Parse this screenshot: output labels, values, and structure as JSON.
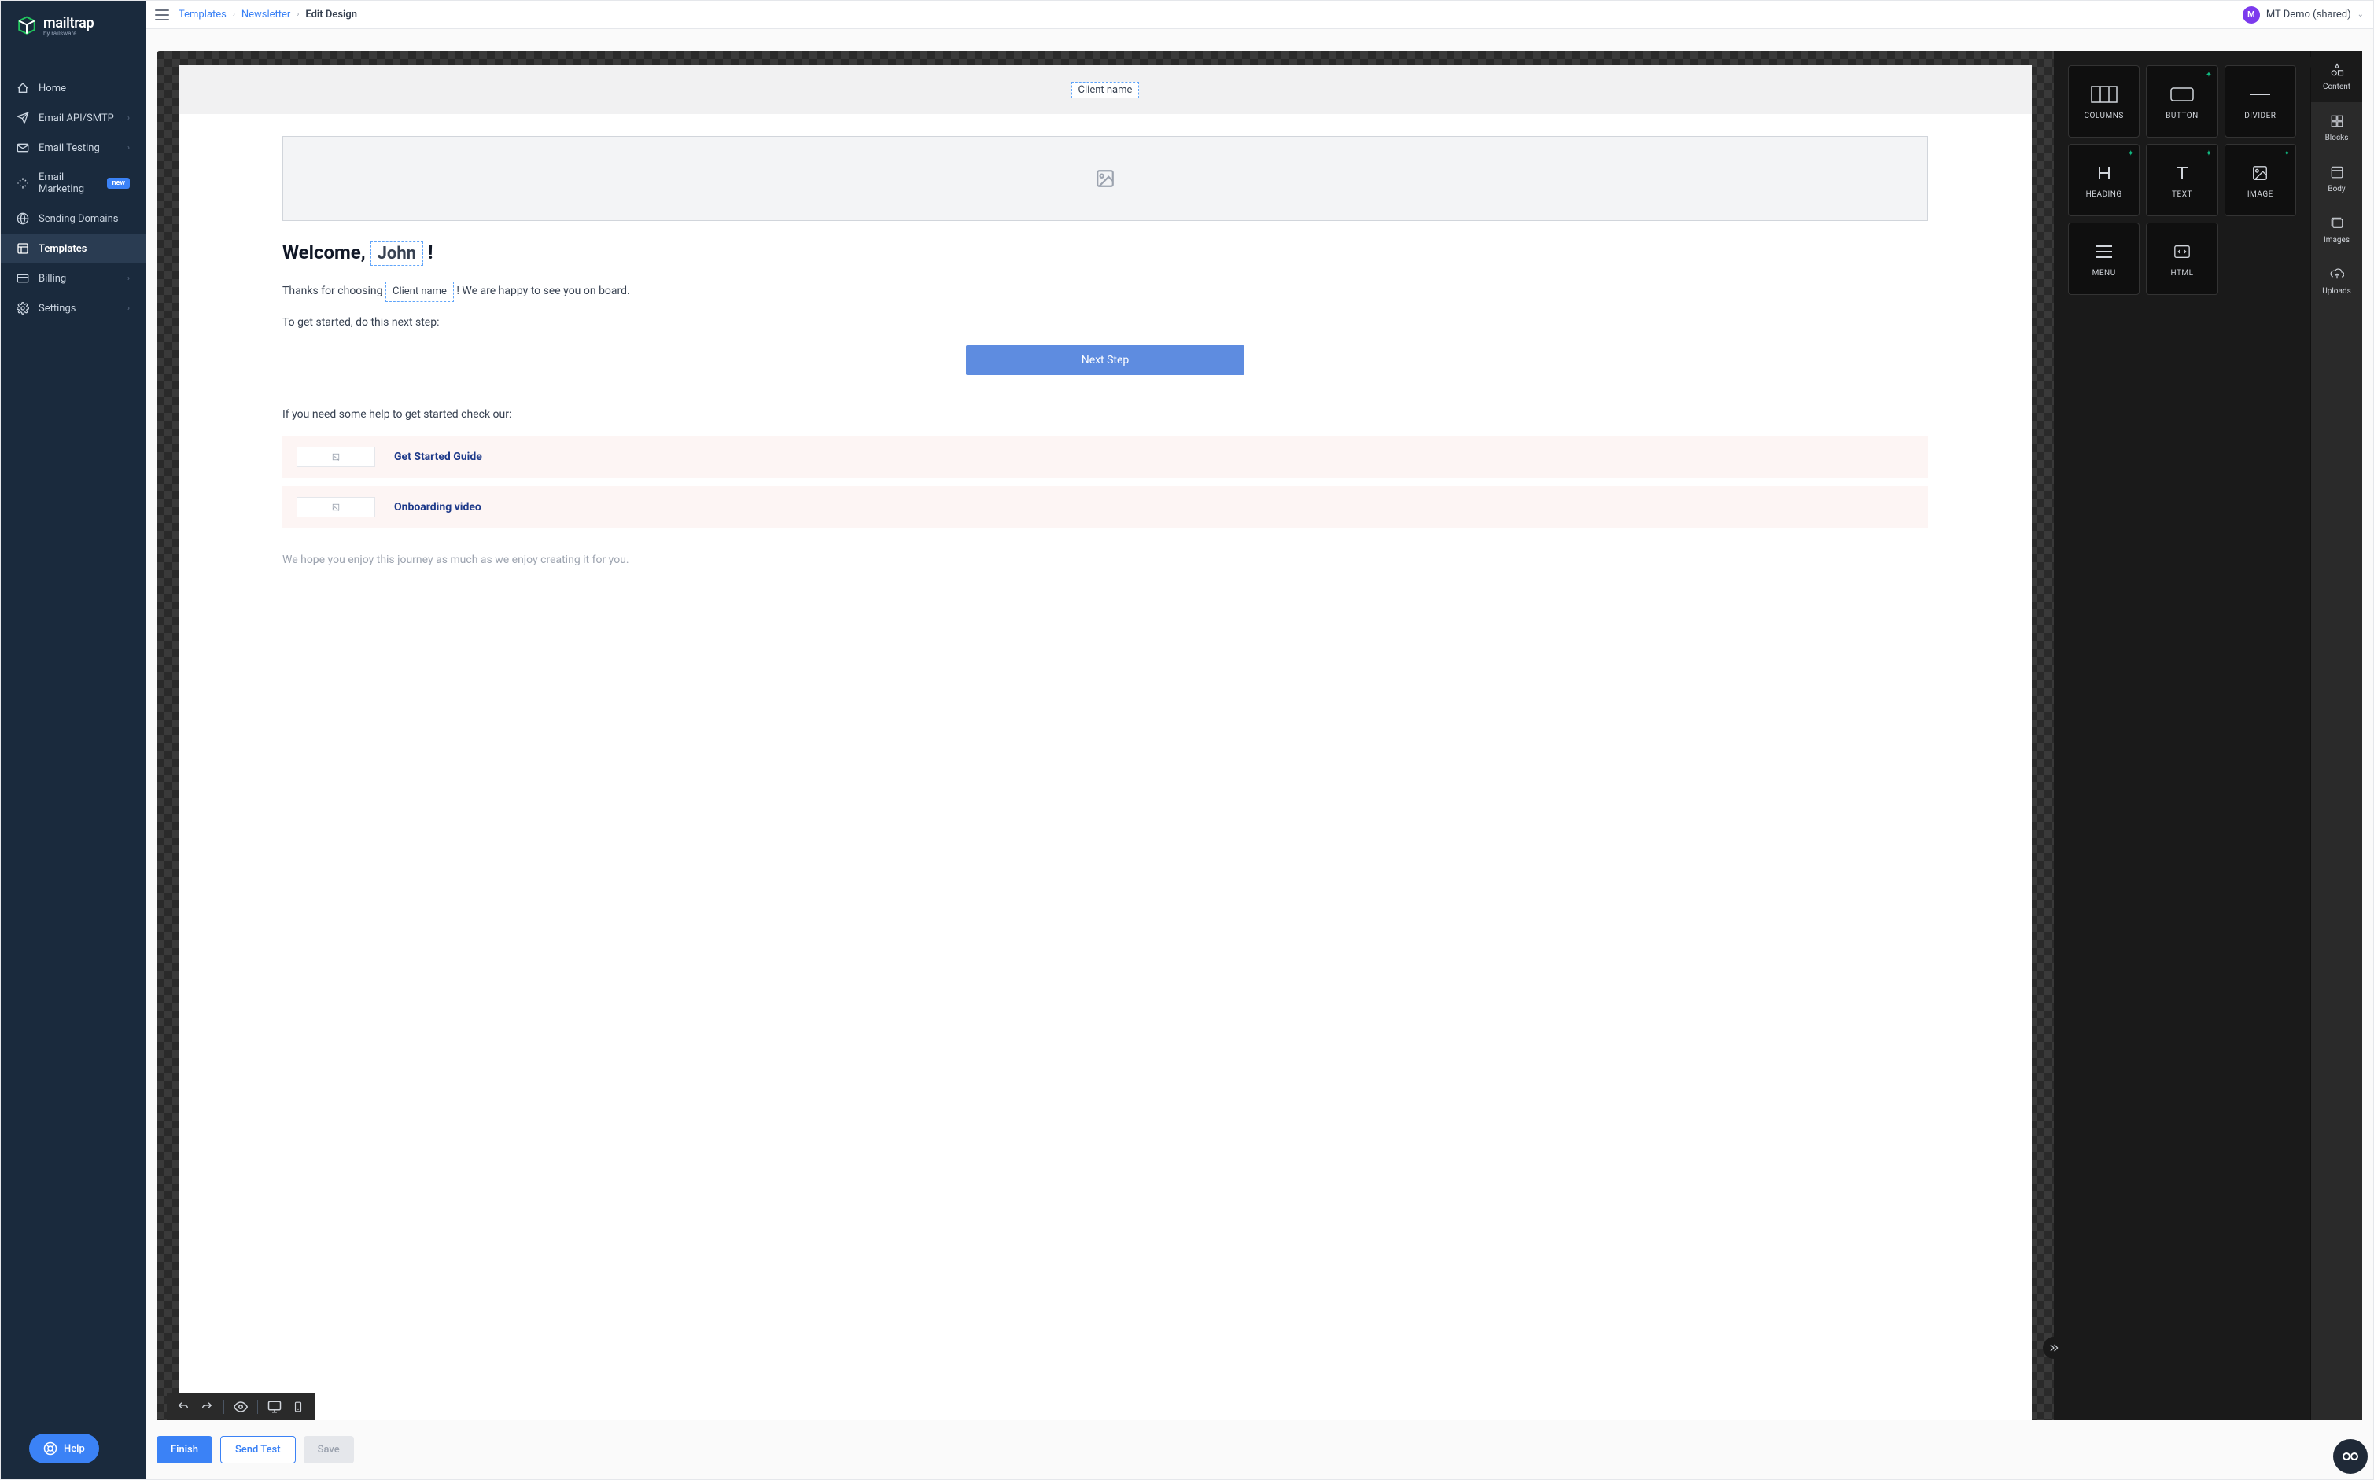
{
  "brand": {
    "name": "mailtrap",
    "sub": "by railsware"
  },
  "nav": {
    "home": "Home",
    "api": "Email API/SMTP",
    "testing": "Email Testing",
    "marketing": "Email Marketing",
    "marketing_badge": "new",
    "domains": "Sending Domains",
    "templates": "Templates",
    "billing": "Billing",
    "settings": "Settings",
    "help": "Help"
  },
  "breadcrumb": {
    "templates": "Templates",
    "newsletter": "Newsletter",
    "current": "Edit Design"
  },
  "user": {
    "initial": "M",
    "name": "MT Demo (shared)"
  },
  "email": {
    "header_merge": "Client name",
    "welcome_pre": "Welcome, ",
    "welcome_merge": "John",
    "welcome_post": " !",
    "thanks_pre": "Thanks for choosing ",
    "thanks_merge": "Client name",
    "thanks_post": " ! We are happy to see you on board.",
    "getstarted": "To get started, do this next step:",
    "cta": "Next Step",
    "helpline": "If you need some help to get started check our:",
    "resources": [
      {
        "title": "Get Started Guide"
      },
      {
        "title": "Onboarding video"
      }
    ],
    "footer": "We hope you enjoy this journey as much as we enjoy creating it for you."
  },
  "widgets": {
    "columns": "COLUMNS",
    "button": "BUTTON",
    "divider": "DIVIDER",
    "heading": "HEADING",
    "text": "TEXT",
    "image": "IMAGE",
    "menu": "MENU",
    "html": "HTML"
  },
  "tabs": {
    "content": "Content",
    "blocks": "Blocks",
    "body": "Body",
    "images": "Images",
    "uploads": "Uploads"
  },
  "footer_btns": {
    "finish": "Finish",
    "test": "Send Test",
    "save": "Save"
  }
}
